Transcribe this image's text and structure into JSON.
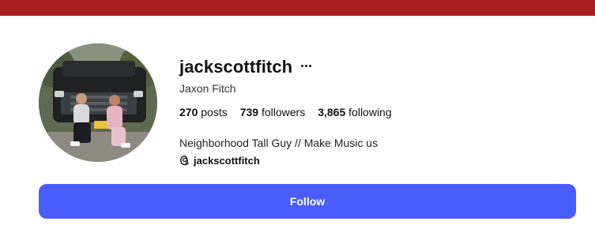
{
  "colors": {
    "top_bar": "#a81d22",
    "follow_button": "#4a5dfb"
  },
  "profile": {
    "username": "jackscottfitch",
    "display_name": "Jaxon Fitch",
    "more_icon": "more-horizontal-icon",
    "avatar_icon": "profile-photo"
  },
  "stats": {
    "posts": {
      "count": "270",
      "label": "posts"
    },
    "followers": {
      "count": "739",
      "label": "followers"
    },
    "following": {
      "count": "3,865",
      "label": "following"
    }
  },
  "bio": {
    "text": "Neighborhood Tall Guy // Make Music us",
    "threads_handle": "jackscottfitch",
    "threads_icon": "threads-icon"
  },
  "actions": {
    "follow_label": "Follow"
  }
}
